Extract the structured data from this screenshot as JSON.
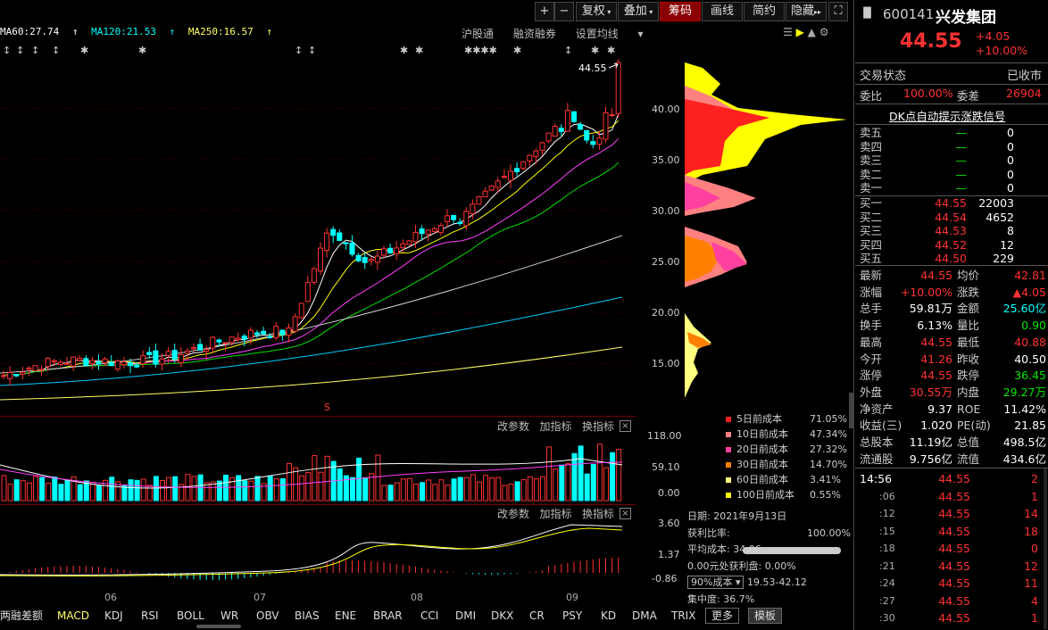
{
  "toolbar": {
    "plus": "+",
    "minus": "−",
    "fuquan": "复权",
    "diejia": "叠加",
    "chouma": "筹码",
    "huaxian": "画线",
    "jianjie": "简约",
    "yincang": "隐藏"
  },
  "ma_legend": {
    "ma60": "MA60:27.74",
    "ma120": "MA120:21.53",
    "ma250": "MA250:16.57"
  },
  "top_links": [
    "沪股通",
    "融资融券",
    "设置均线"
  ],
  "price_label": "44.55",
  "price_axis": [
    "40.00",
    "35.00",
    "30.00",
    "25.00",
    "20.00",
    "15.00"
  ],
  "vol_axis": [
    "118.00",
    "59.10",
    "0.00"
  ],
  "macd_axis": [
    "3.60",
    "1.37",
    "-0.86"
  ],
  "panel_btns": [
    "改参数",
    "加指标",
    "换指标"
  ],
  "panel_close": "×",
  "months": [
    "06",
    "07",
    "08",
    "09"
  ],
  "chip_legend": [
    {
      "label": "5日前成本",
      "value": "71.05%",
      "color": "#ff2020"
    },
    {
      "label": "10日前成本",
      "value": "47.34%",
      "color": "#ff8080"
    },
    {
      "label": "20日前成本",
      "value": "27.32%",
      "color": "#ff40a0"
    },
    {
      "label": "30日前成本",
      "value": "14.70%",
      "color": "#ff8000"
    },
    {
      "label": "60日前成本",
      "value": "3.41%",
      "color": "#ffff80"
    },
    {
      "label": "100日前成本",
      "value": "0.55%",
      "color": "#ffff00"
    }
  ],
  "chip_info": {
    "date": "日期: 2021年9月13日",
    "profit_label": "获利比率:",
    "profit": "100.00%",
    "avg": "平均成本: 34.06",
    "zero": "0.00元处获利盘: 0.00%",
    "range_sel": "90%成本",
    "range": "19.53-42.12",
    "conc": "集中度: 36.7%"
  },
  "bottom_tabs": [
    "两融差额",
    "MACD",
    "KDJ",
    "RSI",
    "BOLL",
    "WR",
    "OBV",
    "BIAS",
    "ENE",
    "BRAR",
    "CCI",
    "DMI",
    "DKX",
    "CR",
    "PSY",
    "KD",
    "DMA",
    "TRIX",
    "更多",
    "模板"
  ],
  "stock": {
    "code": "600141",
    "name": "兴发集团",
    "price": "44.55",
    "change": "+4.05",
    "pct": "+10.00%"
  },
  "status": {
    "label": "交易状态",
    "value": "已收市"
  },
  "weibi": {
    "l1": "委比",
    "v1": "100.00%",
    "l2": "委差",
    "v2": "26904"
  },
  "dk_link": "DK点自动提示涨跌信号",
  "sell": [
    {
      "label": "卖五",
      "price": "—",
      "vol": "0"
    },
    {
      "label": "卖四",
      "price": "—",
      "vol": "0"
    },
    {
      "label": "卖三",
      "price": "—",
      "vol": "0"
    },
    {
      "label": "卖二",
      "price": "—",
      "vol": "0"
    },
    {
      "label": "卖一",
      "price": "—",
      "vol": "0"
    }
  ],
  "buy": [
    {
      "label": "买一",
      "price": "44.55",
      "vol": "22003"
    },
    {
      "label": "买二",
      "price": "44.54",
      "vol": "4652"
    },
    {
      "label": "买三",
      "price": "44.53",
      "vol": "8"
    },
    {
      "label": "买四",
      "price": "44.52",
      "vol": "12"
    },
    {
      "label": "买五",
      "price": "44.50",
      "vol": "229"
    }
  ],
  "quote": [
    {
      "l1": "最新",
      "v1": "44.55",
      "c1": "red",
      "l2": "均价",
      "v2": "42.81",
      "c2": "red"
    },
    {
      "l1": "涨幅",
      "v1": "+10.00%",
      "c1": "red",
      "l2": "涨跌",
      "v2": "▲4.05",
      "c2": "red"
    },
    {
      "l1": "总手",
      "v1": "59.81万",
      "c1": "white",
      "l2": "金额",
      "v2": "25.60亿",
      "c2": "cyan"
    },
    {
      "l1": "换手",
      "v1": "6.13%",
      "c1": "white",
      "l2": "量比",
      "v2": "0.90",
      "c2": "green"
    },
    {
      "l1": "最高",
      "v1": "44.55",
      "c1": "red",
      "l2": "最低",
      "v2": "40.88",
      "c2": "red"
    },
    {
      "l1": "今开",
      "v1": "41.26",
      "c1": "red",
      "l2": "昨收",
      "v2": "40.50",
      "c2": "white"
    },
    {
      "l1": "涨停",
      "v1": "44.55",
      "c1": "red",
      "l2": "跌停",
      "v2": "36.45",
      "c2": "green"
    },
    {
      "l1": "外盘",
      "v1": "30.55万",
      "c1": "red",
      "l2": "内盘",
      "v2": "29.27万",
      "c2": "green"
    },
    {
      "l1": "净资产",
      "v1": "9.37",
      "c1": "white",
      "l2": "ROE",
      "v2": "11.42%",
      "c2": "white"
    },
    {
      "l1": "收益(三)",
      "v1": "1.020",
      "c1": "white",
      "l2": "PE(动)",
      "v2": "21.85",
      "c2": "white"
    },
    {
      "l1": "总股本",
      "v1": "11.19亿",
      "c1": "white",
      "l2": "总值",
      "v2": "498.5亿",
      "c2": "white"
    },
    {
      "l1": "流通股",
      "v1": "9.756亿",
      "c1": "white",
      "l2": "流值",
      "v2": "434.6亿",
      "c2": "white"
    }
  ],
  "ticks": [
    {
      "t": "14:56",
      "p": "44.55",
      "v": "2"
    },
    {
      "t": ":06",
      "p": "44.55",
      "v": "1"
    },
    {
      "t": ":12",
      "p": "44.55",
      "v": "14"
    },
    {
      "t": ":15",
      "p": "44.55",
      "v": "18"
    },
    {
      "t": ":18",
      "p": "44.55",
      "v": "0"
    },
    {
      "t": ":21",
      "p": "44.55",
      "v": "12"
    },
    {
      "t": ":24",
      "p": "44.55",
      "v": "11"
    },
    {
      "t": ":27",
      "p": "44.55",
      "v": "4"
    },
    {
      "t": ":30",
      "p": "44.55",
      "v": "1"
    }
  ]
}
